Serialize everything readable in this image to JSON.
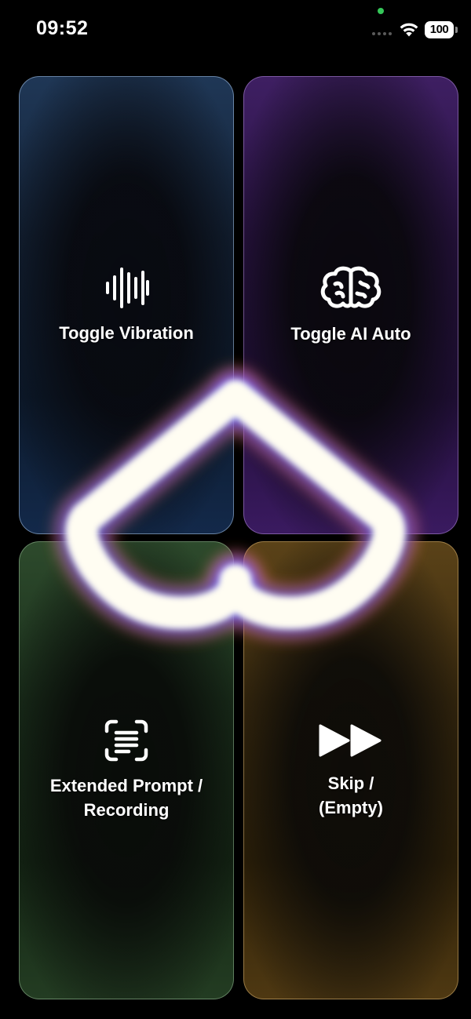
{
  "status_bar": {
    "time": "09:52",
    "battery": "100"
  },
  "tiles": [
    {
      "label": "Toggle Vibration",
      "icon": "waveform-icon",
      "accent": "#1f3756"
    },
    {
      "label": "Toggle AI Auto",
      "icon": "brain-icon",
      "accent": "#3e1f62"
    },
    {
      "label": "Extended Prompt /\nRecording",
      "icon": "scan-text-icon",
      "accent": "#2d4a2c"
    },
    {
      "label": "Skip /\n(Empty)",
      "icon": "fast-forward-icon",
      "accent": "#5a4218"
    }
  ]
}
